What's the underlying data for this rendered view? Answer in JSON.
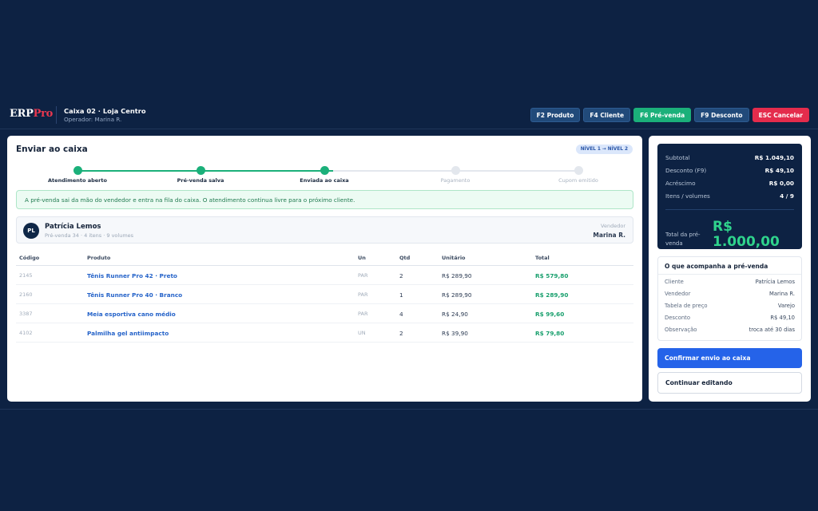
{
  "app": {
    "logo_main": "ERP",
    "logo_accent": "Pro",
    "store": "Caixa 02 · Loja Centro",
    "operator": "Operador: Marina R."
  },
  "hotkeys": [
    {
      "label": "F2 Produto",
      "style": "default"
    },
    {
      "label": "F4 Cliente",
      "style": "default"
    },
    {
      "label": "F6 Pré-venda",
      "style": "green"
    },
    {
      "label": "F9 Desconto",
      "style": "default"
    },
    {
      "label": "ESC Cancelar",
      "style": "red"
    }
  ],
  "main": {
    "title": "Enviar ao caixa",
    "level_badge": "NÍVEL 1 → NÍVEL 2",
    "steps": [
      {
        "label": "Atendimento aberto",
        "done": true
      },
      {
        "label": "Pré-venda salva",
        "done": true
      },
      {
        "label": "Enviada ao caixa",
        "done": true
      },
      {
        "label": "Pagamento",
        "done": false
      },
      {
        "label": "Cupom emitido",
        "done": false
      }
    ],
    "alert": "A pré-venda sai da mão do vendedor e entra na fila do caixa. O atendimento continua livre para o próximo cliente.",
    "customer": {
      "initials": "PL",
      "name": "Patrícia Lemos",
      "meta": "Pré-venda 34 · 4 itens · 9 volumes",
      "seller_label": "Vendedor",
      "seller_name": "Marina R."
    },
    "table": {
      "headers": [
        "Código",
        "Produto",
        "Un",
        "Qtd",
        "Unitário",
        "Total"
      ],
      "rows": [
        {
          "code": "2145",
          "product": "Tênis Runner Pro 42 · Preto",
          "un": "PAR",
          "qty": "2",
          "unit": "R$ 289,90",
          "total": "R$ 579,80"
        },
        {
          "code": "2160",
          "product": "Tênis Runner Pro 40 · Branco",
          "un": "PAR",
          "qty": "1",
          "unit": "R$ 289,90",
          "total": "R$ 289,90"
        },
        {
          "code": "3387",
          "product": "Meia esportiva cano médio",
          "un": "PAR",
          "qty": "4",
          "unit": "R$ 24,90",
          "total": "R$ 99,60"
        },
        {
          "code": "4102",
          "product": "Palmilha gel antiimpacto",
          "un": "UN",
          "qty": "2",
          "unit": "R$ 39,90",
          "total": "R$ 79,80"
        }
      ]
    }
  },
  "summary": {
    "rows": [
      {
        "label": "Subtotal",
        "value": "R$ 1.049,10"
      },
      {
        "label": "Desconto (F9)",
        "value": "R$ 49,10"
      },
      {
        "label": "Acréscimo",
        "value": "R$ 0,00"
      },
      {
        "label": "Itens / volumes",
        "value": "4 / 9"
      }
    ],
    "total_label": "Total da pré-venda",
    "total_value": "R$ 1.000,00"
  },
  "extras": {
    "title": "O que acompanha a pré-venda",
    "rows": [
      {
        "label": "Cliente",
        "value": "Patrícia Lemos"
      },
      {
        "label": "Vendedor",
        "value": "Marina R."
      },
      {
        "label": "Tabela de preço",
        "value": "Varejo"
      },
      {
        "label": "Desconto",
        "value": "R$ 49,10"
      },
      {
        "label": "Observação",
        "value": "troca até 30 dias"
      }
    ]
  },
  "actions": {
    "confirm": "Confirmar envio ao caixa",
    "edit": "Continuar editando"
  },
  "colors": {
    "background": "#0d2243",
    "accent_green": "#1bb07a",
    "accent_red": "#e42c4c",
    "accent_blue": "#2563e9",
    "total_green": "#2fd38c"
  }
}
